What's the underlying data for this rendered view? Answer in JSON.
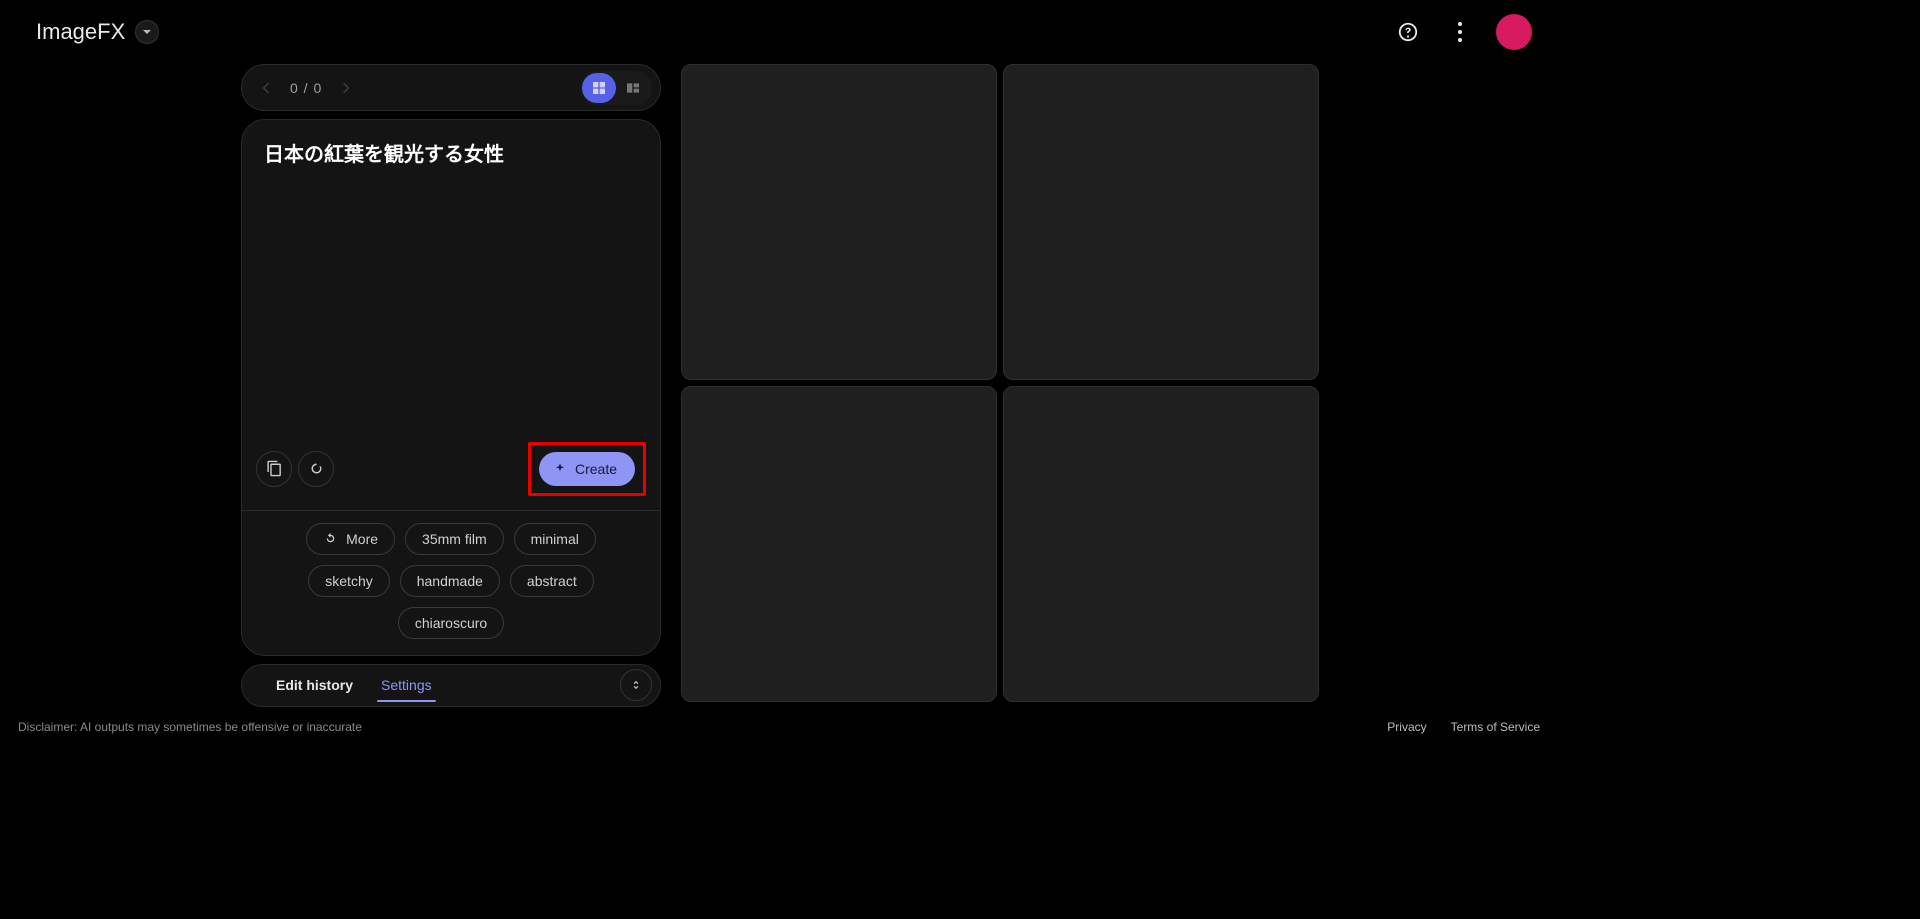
{
  "brand": {
    "name": "ImageFX"
  },
  "nav": {
    "count": "0 / 0"
  },
  "prompt": {
    "text": "日本の紅葉を観光する女性"
  },
  "actions": {
    "create": "Create",
    "more": "More"
  },
  "chips": [
    "35mm film",
    "minimal",
    "sketchy",
    "handmade",
    "abstract",
    "chiaroscuro"
  ],
  "tabs": {
    "history": "Edit history",
    "settings": "Settings"
  },
  "footer": {
    "disclaimer": "Disclaimer: AI outputs may sometimes be offensive or inaccurate",
    "privacy": "Privacy",
    "tos": "Terms of Service"
  }
}
